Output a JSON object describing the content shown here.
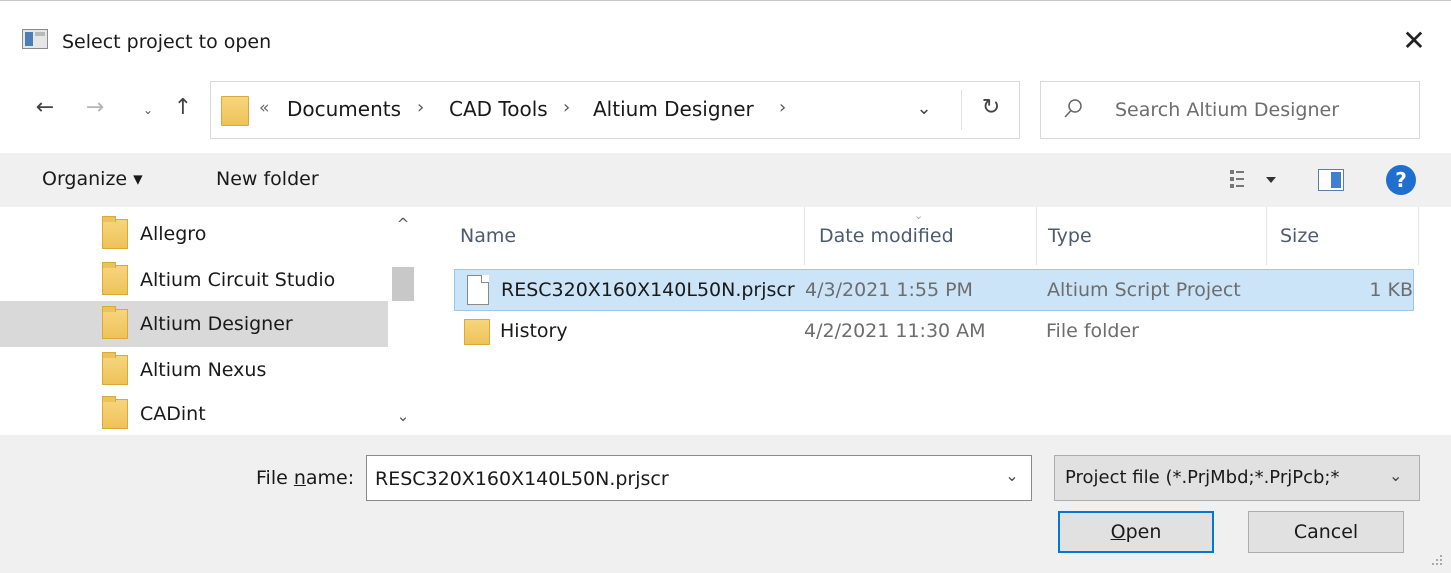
{
  "window": {
    "title": "Select project to open",
    "close_glyph": "✕"
  },
  "nav": {
    "back_glyph": "←",
    "forward_glyph": "→",
    "recent_glyph": "⌄",
    "up_glyph": "↑",
    "breadcrumb_overflow": "«",
    "breadcrumbs": [
      "Documents",
      "CAD Tools",
      "Altium Designer"
    ],
    "separator": "›",
    "dropdown_glyph": "⌄",
    "refresh_glyph": "↻"
  },
  "search": {
    "placeholder": "Search Altium Designer",
    "value": ""
  },
  "toolbar": {
    "organize_label": "Organize ▾",
    "new_folder_label": "New folder",
    "help_glyph": "?"
  },
  "sidebar": {
    "items": [
      {
        "label": "Allegro",
        "selected": false
      },
      {
        "label": "Altium Circuit Studio",
        "selected": false
      },
      {
        "label": "Altium Designer",
        "selected": true
      },
      {
        "label": "Altium Nexus",
        "selected": false
      },
      {
        "label": "CADint",
        "selected": false
      }
    ],
    "scroll_up_glyph": "^",
    "scroll_down_glyph": "⌄"
  },
  "filelist": {
    "columns": [
      "Name",
      "Date modified",
      "Type",
      "Size"
    ],
    "sort_glyph": "⌄",
    "rows": [
      {
        "icon": "file-icon",
        "name": "RESC320X160X140L50N.prjscr",
        "date": "4/3/2021 1:55 PM",
        "type": "Altium Script Project",
        "size": "1 KB",
        "selected": true
      },
      {
        "icon": "folder-icon",
        "name": "History",
        "date": "4/2/2021 11:30 AM",
        "type": "File folder",
        "size": "",
        "selected": false
      }
    ]
  },
  "bottom": {
    "file_name_label_pre": "File ",
    "file_name_label_ul": "n",
    "file_name_label_post": "ame:",
    "file_name_value": "RESC320X160X140L50N.prjscr",
    "combo_drop_glyph": "⌄",
    "filter_label": "Project file (*.PrjMbd;*.PrjPcb;*",
    "filter_drop_glyph": "⌄",
    "open_ul": "O",
    "open_rest": "pen",
    "cancel_label": "Cancel"
  },
  "colors": {
    "selection": "#cce4f7",
    "selection_border": "#99c9ef",
    "accent": "#0078d7",
    "help": "#1f6fd0",
    "folder": "#eec25a"
  }
}
